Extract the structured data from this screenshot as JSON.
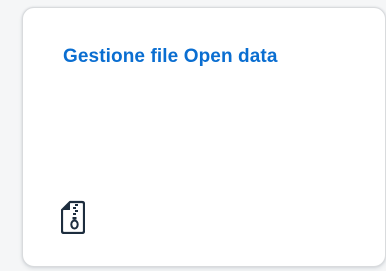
{
  "tile": {
    "title": "Gestione file Open data",
    "icon": "zip-file-icon",
    "accent_color": "#0a6ed1",
    "icon_color": "#1d2d3e"
  }
}
